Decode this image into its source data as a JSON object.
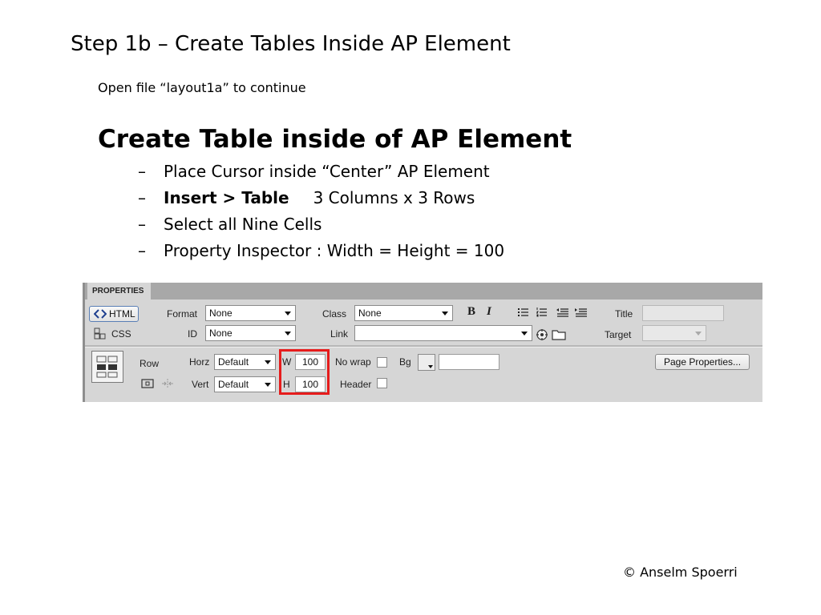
{
  "slide": {
    "title": "Step 1b – Create Tables Inside AP Element",
    "subtitle": "Open file “layout1a” to continue",
    "heading": "Create Table inside of AP Element",
    "steps": [
      {
        "dash": "–",
        "text": "Place Cursor inside “Center” AP Element"
      },
      {
        "dash": "–",
        "bold": "Insert > Table",
        "text": "3 Columns x 3 Rows"
      },
      {
        "dash": "–",
        "text": "Select all Nine Cells"
      },
      {
        "dash": "–",
        "text": "Property Inspector : Width = Height = 100"
      }
    ],
    "copyright": "© Anselm Spoerri"
  },
  "panel": {
    "tab_label": "PROPERTIES",
    "html_button": "HTML",
    "css_button": "CSS",
    "format": {
      "label": "Format",
      "value": "None"
    },
    "id": {
      "label": "ID",
      "value": "None"
    },
    "class": {
      "label": "Class",
      "value": "None"
    },
    "link": {
      "label": "Link",
      "value": ""
    },
    "title": {
      "label": "Title",
      "value": ""
    },
    "target": {
      "label": "Target",
      "value": ""
    },
    "bold_glyph": "B",
    "italic_glyph": "I",
    "row_label": "Row",
    "horz": {
      "label": "Horz",
      "value": "Default"
    },
    "vert": {
      "label": "Vert",
      "value": "Default"
    },
    "width": {
      "label": "W",
      "value": "100"
    },
    "height": {
      "label": "H",
      "value": "100"
    },
    "no_wrap_label": "No wrap",
    "header_label": "Header",
    "bg": {
      "label": "Bg",
      "value": ""
    },
    "page_properties_button": "Page Properties..."
  },
  "colors": {
    "highlight": "#e61c1c",
    "panel_bg": "#d6d6d6",
    "tab_bar": "#a8a8a8"
  }
}
